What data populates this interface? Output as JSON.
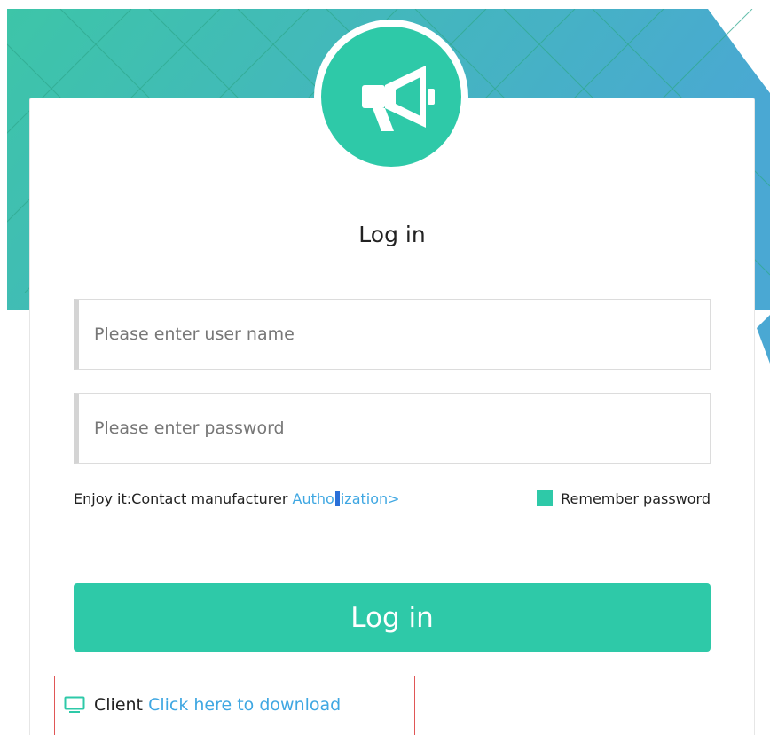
{
  "colors": {
    "accent": "#2ec9a8",
    "banner_gradient_start": "#3dc5a8",
    "banner_gradient_end": "#4aa8d3",
    "link": "#3fa7e2",
    "client_box_border": "#e05656"
  },
  "logo": {
    "icon": "megaphone-icon"
  },
  "form": {
    "title": "Log in",
    "username_placeholder": "Please enter user name",
    "password_placeholder": "Please enter password",
    "hint_text": "Enjoy it:Contact manufacturer ",
    "auth_link_start": "Autho",
    "auth_link_end": "ization>",
    "remember_label": "Remember password",
    "submit_label": "Log in"
  },
  "client": {
    "icon": "monitor-icon",
    "label": "Client",
    "download_link": "Click here to download"
  }
}
